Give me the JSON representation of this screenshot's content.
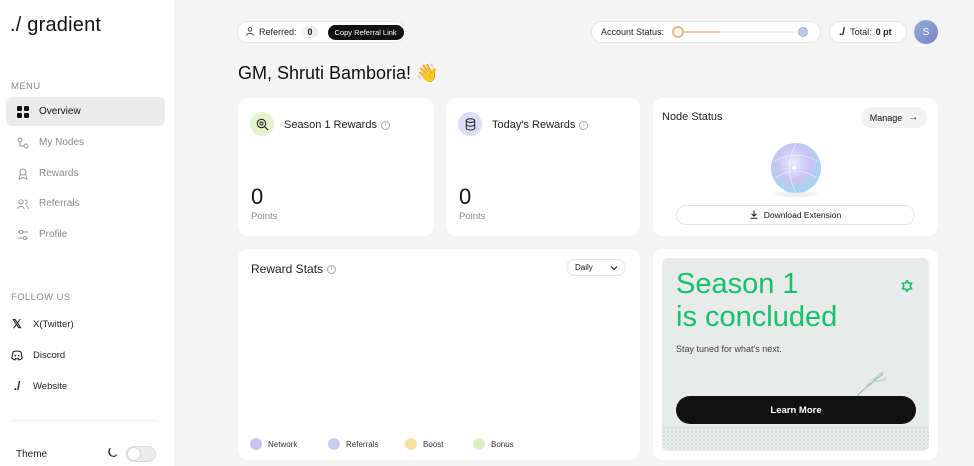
{
  "sidebar": {
    "logo": "./ gradient",
    "menu_label": "MENU",
    "menu_items": [
      {
        "label": "Overview",
        "icon": "grid-icon"
      },
      {
        "label": "My Nodes",
        "icon": "nodes-icon"
      },
      {
        "label": "Rewards",
        "icon": "rewards-icon"
      },
      {
        "label": "Referrals",
        "icon": "referrals-icon"
      },
      {
        "label": "Profile",
        "icon": "profile-icon"
      }
    ],
    "active_item": "Overview",
    "follow_label": "FOLLOW US",
    "follow_items": [
      {
        "label": "X(Twitter)",
        "icon": "x-icon"
      },
      {
        "label": "Discord",
        "icon": "discord-icon"
      },
      {
        "label": "Website",
        "icon": "website-icon"
      }
    ],
    "theme_label": "Theme"
  },
  "topbar": {
    "referred_label": "Referred:",
    "referred_count": "0",
    "copy_link_label": "Copy Referral Link",
    "account_status_label": "Account Status:",
    "account_status_progress": 0.35,
    "total_label": "Total:",
    "total_value": "0 pt",
    "avatar_initial": "S"
  },
  "greeting": "GM, Shruti Bamboria! 👋",
  "cards": {
    "season_rewards": {
      "title": "Season 1 Rewards",
      "value": "0",
      "unit": "Points"
    },
    "today_rewards": {
      "title": "Today's Rewards",
      "value": "0",
      "unit": "Points"
    },
    "node_status": {
      "title": "Node Status",
      "manage_label": "Manage",
      "download_label": "Download Extension"
    },
    "reward_stats": {
      "title": "Reward Stats",
      "period": "Daily",
      "legend": [
        {
          "label": "Network",
          "color": "#c7c3f2"
        },
        {
          "label": "Referrals",
          "color": "#c9cdf5"
        },
        {
          "label": "Boost",
          "color": "#f6e3a1"
        },
        {
          "label": "Bonus",
          "color": "#dcf0c2"
        }
      ]
    },
    "promo": {
      "title_line1": "Season 1",
      "title_line2": "is concluded",
      "subtitle": "Stay tuned for what's next.",
      "button_label": "Learn More",
      "accent_color": "#15c26b"
    }
  }
}
